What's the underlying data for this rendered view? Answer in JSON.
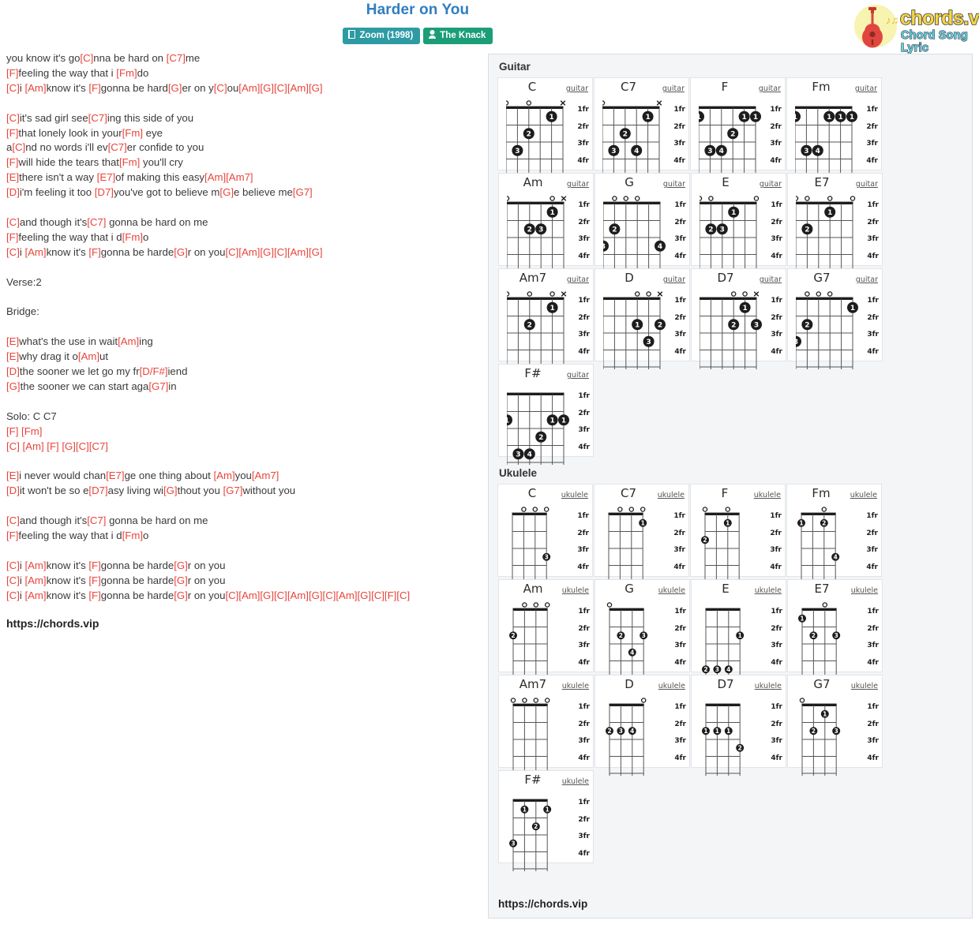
{
  "header": {
    "title": "Harder on You",
    "album_badge": "Zoom (1998)",
    "artist_badge": "The Knack",
    "album_icon": "book-icon",
    "artist_icon": "user-icon"
  },
  "logo": {
    "brand": "chords.vip",
    "tagline": "Chord Song Lyric",
    "icon": "guitar-icon",
    "note_icon": "music-note-icon",
    "disc_color": "#f7f3b0",
    "brand_color": "#f5d547",
    "tagline_color": "#63d2e8",
    "guitar_color": "#e0453f"
  },
  "colors": {
    "title": "#2f7ec0",
    "chord": "#e8453c",
    "album_badge": "#2e9ba4",
    "artist_badge": "#1b9e78",
    "panel_bg": "#f3f5f7"
  },
  "lyrics": {
    "footer_link": "https://chords.vip",
    "lines": [
      [
        {
          "t": "you know it's go"
        },
        {
          "c": "[C]"
        },
        {
          "t": "nna be hard on "
        },
        {
          "c": "[C7]"
        },
        {
          "t": "me"
        }
      ],
      [
        {
          "c": "[F]"
        },
        {
          "t": "feeling the way that i "
        },
        {
          "c": "[Fm]"
        },
        {
          "t": "do"
        }
      ],
      [
        {
          "c": "[C]"
        },
        {
          "t": "i "
        },
        {
          "c": "[Am]"
        },
        {
          "t": "know it's "
        },
        {
          "c": "[F]"
        },
        {
          "t": "gonna be hard"
        },
        {
          "c": "[G]"
        },
        {
          "t": "er on y"
        },
        {
          "c": "[C]"
        },
        {
          "t": "ou"
        },
        {
          "c": "[Am][G][C][Am][G]"
        }
      ],
      [],
      [
        {
          "c": "[C]"
        },
        {
          "t": "it's sad girl see"
        },
        {
          "c": "[C7]"
        },
        {
          "t": "ing this side of you"
        }
      ],
      [
        {
          "c": "[F]"
        },
        {
          "t": "that lonely look in your"
        },
        {
          "c": "[Fm]"
        },
        {
          "t": " eye"
        }
      ],
      [
        {
          "t": "a"
        },
        {
          "c": "[C]"
        },
        {
          "t": "nd no words i'll ev"
        },
        {
          "c": "[C7]"
        },
        {
          "t": "er confide to you"
        }
      ],
      [
        {
          "c": "[F]"
        },
        {
          "t": "will hide the tears that"
        },
        {
          "c": "[Fm]"
        },
        {
          "t": " you'll cry"
        }
      ],
      [
        {
          "c": "[E]"
        },
        {
          "t": "there isn't a way "
        },
        {
          "c": "[E7]"
        },
        {
          "t": "of making this easy"
        },
        {
          "c": "[Am][Am7]"
        }
      ],
      [
        {
          "c": "[D]"
        },
        {
          "t": "i'm feeling it too "
        },
        {
          "c": "[D7]"
        },
        {
          "t": "you've got to believe m"
        },
        {
          "c": "[G]"
        },
        {
          "t": "e believe me"
        },
        {
          "c": "[G7]"
        }
      ],
      [],
      [
        {
          "c": "[C]"
        },
        {
          "t": "and though it's"
        },
        {
          "c": "[C7]"
        },
        {
          "t": " gonna be hard on me"
        }
      ],
      [
        {
          "c": "[F]"
        },
        {
          "t": "feeling the way that i d"
        },
        {
          "c": "[Fm]"
        },
        {
          "t": "o"
        }
      ],
      [
        {
          "c": "[C]"
        },
        {
          "t": "i "
        },
        {
          "c": "[Am]"
        },
        {
          "t": "know it's "
        },
        {
          "c": "[F]"
        },
        {
          "t": "gonna be harde"
        },
        {
          "c": "[G]"
        },
        {
          "t": "r on you"
        },
        {
          "c": "[C][Am][G][C][Am][G]"
        }
      ],
      [],
      [
        {
          "t": "Verse:2"
        }
      ],
      [],
      [
        {
          "t": "Bridge:"
        }
      ],
      [],
      [
        {
          "c": "[E]"
        },
        {
          "t": "what's the use in wait"
        },
        {
          "c": "[Am]"
        },
        {
          "t": "ing"
        }
      ],
      [
        {
          "c": "[E]"
        },
        {
          "t": "why drag it o"
        },
        {
          "c": "[Am]"
        },
        {
          "t": "ut"
        }
      ],
      [
        {
          "c": "[D]"
        },
        {
          "t": "the sooner we let go my fr"
        },
        {
          "c": "[D/F#]"
        },
        {
          "t": "iend"
        }
      ],
      [
        {
          "c": "[G]"
        },
        {
          "t": "the sooner we can start aga"
        },
        {
          "c": "[G7]"
        },
        {
          "t": "in"
        }
      ],
      [],
      [
        {
          "t": "Solo: C C7"
        }
      ],
      [
        {
          "c": "[F] [Fm]"
        }
      ],
      [
        {
          "c": "[C] [Am] [F] [G][C][C7]"
        }
      ],
      [],
      [
        {
          "c": "[E]"
        },
        {
          "t": "i never would chan"
        },
        {
          "c": "[E7]"
        },
        {
          "t": "ge one thing about "
        },
        {
          "c": "[Am]"
        },
        {
          "t": "you"
        },
        {
          "c": "[Am7]"
        }
      ],
      [
        {
          "c": "[D]"
        },
        {
          "t": "it won't be so e"
        },
        {
          "c": "[D7]"
        },
        {
          "t": "asy living wi"
        },
        {
          "c": "[G]"
        },
        {
          "t": "thout you "
        },
        {
          "c": "[G7]"
        },
        {
          "t": "without you"
        }
      ],
      [],
      [
        {
          "c": "[C]"
        },
        {
          "t": "and though it's"
        },
        {
          "c": "[C7]"
        },
        {
          "t": " gonna be hard on me"
        }
      ],
      [
        {
          "c": "[F]"
        },
        {
          "t": "feeling the way that i d"
        },
        {
          "c": "[Fm]"
        },
        {
          "t": "o"
        }
      ],
      [],
      [
        {
          "c": "[C]"
        },
        {
          "t": "i "
        },
        {
          "c": "[Am]"
        },
        {
          "t": "know it's "
        },
        {
          "c": "[F]"
        },
        {
          "t": "gonna be harde"
        },
        {
          "c": "[G]"
        },
        {
          "t": "r on you"
        }
      ],
      [
        {
          "c": "[C]"
        },
        {
          "t": "i "
        },
        {
          "c": "[Am]"
        },
        {
          "t": "know it's "
        },
        {
          "c": "[F]"
        },
        {
          "t": "gonna be harde"
        },
        {
          "c": "[G]"
        },
        {
          "t": "r on you"
        }
      ],
      [
        {
          "c": "[C]"
        },
        {
          "t": "i "
        },
        {
          "c": "[Am]"
        },
        {
          "t": "know it's "
        },
        {
          "c": "[F]"
        },
        {
          "t": "gonna be harde"
        },
        {
          "c": "[G]"
        },
        {
          "t": "r on you"
        },
        {
          "c": "[C][Am][G][C][Am][G][C][Am][G][C][F][C]"
        }
      ]
    ]
  },
  "panel": {
    "guitar_section": "Guitar",
    "ukulele_section": "Ukulele",
    "footer_link": "https://chords.vip",
    "fret_labels": [
      "1fr",
      "2fr",
      "3fr",
      "4fr"
    ],
    "guitar_instrument_label": "guitar",
    "ukulele_instrument_label": "ukulele"
  },
  "guitar_chords": [
    {
      "name": "C",
      "open": [
        "x",
        "",
        "",
        "o",
        "",
        "o"
      ],
      "dots": [
        {
          "s": 2,
          "f": 1,
          "n": 1
        },
        {
          "s": 4,
          "f": 2,
          "n": 2
        },
        {
          "s": 5,
          "f": 3,
          "n": 3
        }
      ]
    },
    {
      "name": "C7",
      "open": [
        "x",
        "",
        "",
        "",
        "",
        "o"
      ],
      "dots": [
        {
          "s": 2,
          "f": 1,
          "n": 1
        },
        {
          "s": 4,
          "f": 2,
          "n": 2
        },
        {
          "s": 5,
          "f": 3,
          "n": 3
        },
        {
          "s": 3,
          "f": 3,
          "n": 4
        }
      ]
    },
    {
      "name": "F",
      "open": [
        "",
        "",
        "",
        "",
        "",
        ""
      ],
      "dots": [
        {
          "s": 6,
          "f": 1,
          "n": 1
        },
        {
          "s": 2,
          "f": 1,
          "n": 1
        },
        {
          "s": 1,
          "f": 1,
          "n": 1
        },
        {
          "s": 3,
          "f": 2,
          "n": 2
        },
        {
          "s": 5,
          "f": 3,
          "n": 3
        },
        {
          "s": 4,
          "f": 3,
          "n": 4
        }
      ]
    },
    {
      "name": "Fm",
      "open": [
        "",
        "",
        "",
        "",
        "",
        ""
      ],
      "dots": [
        {
          "s": 6,
          "f": 1,
          "n": 1
        },
        {
          "s": 3,
          "f": 1,
          "n": 1
        },
        {
          "s": 2,
          "f": 1,
          "n": 1
        },
        {
          "s": 1,
          "f": 1,
          "n": 1
        },
        {
          "s": 5,
          "f": 3,
          "n": 3
        },
        {
          "s": 4,
          "f": 3,
          "n": 4
        }
      ]
    },
    {
      "name": "Am",
      "open": [
        "x",
        "o",
        "",
        "",
        "",
        "o"
      ],
      "dots": [
        {
          "s": 2,
          "f": 1,
          "n": 1
        },
        {
          "s": 4,
          "f": 2,
          "n": 2
        },
        {
          "s": 3,
          "f": 2,
          "n": 3
        }
      ]
    },
    {
      "name": "G",
      "open": [
        "",
        "",
        "o",
        "o",
        "o",
        ""
      ],
      "dots": [
        {
          "s": 6,
          "f": 3,
          "n": 3
        },
        {
          "s": 5,
          "f": 2,
          "n": 2
        },
        {
          "s": 1,
          "f": 3,
          "n": 4
        }
      ]
    },
    {
      "name": "E",
      "open": [
        "o",
        "",
        "",
        "",
        "o",
        "o"
      ],
      "dots": [
        {
          "s": 3,
          "f": 1,
          "n": 1
        },
        {
          "s": 5,
          "f": 2,
          "n": 2
        },
        {
          "s": 4,
          "f": 2,
          "n": 3
        }
      ]
    },
    {
      "name": "E7",
      "open": [
        "o",
        "",
        "o",
        "",
        "o",
        "o"
      ],
      "dots": [
        {
          "s": 3,
          "f": 1,
          "n": 1
        },
        {
          "s": 5,
          "f": 2,
          "n": 2
        }
      ]
    },
    {
      "name": "Am7",
      "open": [
        "x",
        "o",
        "",
        "o",
        "",
        "o"
      ],
      "dots": [
        {
          "s": 2,
          "f": 1,
          "n": 1
        },
        {
          "s": 4,
          "f": 2,
          "n": 2
        }
      ]
    },
    {
      "name": "D",
      "open": [
        "x",
        "o",
        "o",
        "",
        "",
        ""
      ],
      "dots": [
        {
          "s": 3,
          "f": 2,
          "n": 1
        },
        {
          "s": 1,
          "f": 2,
          "n": 2
        },
        {
          "s": 2,
          "f": 3,
          "n": 3
        }
      ]
    },
    {
      "name": "D7",
      "open": [
        "x",
        "o",
        "o",
        "",
        "",
        ""
      ],
      "dots": [
        {
          "s": 2,
          "f": 1,
          "n": 1
        },
        {
          "s": 3,
          "f": 2,
          "n": 2
        },
        {
          "s": 1,
          "f": 2,
          "n": 3
        }
      ]
    },
    {
      "name": "G7",
      "open": [
        "",
        "",
        "o",
        "o",
        "o",
        ""
      ],
      "dots": [
        {
          "s": 1,
          "f": 1,
          "n": 1
        },
        {
          "s": 5,
          "f": 2,
          "n": 2
        },
        {
          "s": 6,
          "f": 3,
          "n": 3
        }
      ]
    },
    {
      "name": "F#",
      "open": [
        "",
        "",
        "",
        "",
        "",
        ""
      ],
      "dots": [
        {
          "s": 6,
          "f": 2,
          "n": 1
        },
        {
          "s": 2,
          "f": 2,
          "n": 1
        },
        {
          "s": 1,
          "f": 2,
          "n": 1
        },
        {
          "s": 3,
          "f": 3,
          "n": 2
        },
        {
          "s": 5,
          "f": 4,
          "n": 3
        },
        {
          "s": 4,
          "f": 4,
          "n": 4
        }
      ]
    }
  ],
  "ukulele_chords": [
    {
      "name": "C",
      "open": [
        "o",
        "o",
        "o",
        ""
      ],
      "dots": [
        {
          "s": 1,
          "f": 3,
          "n": 3
        }
      ]
    },
    {
      "name": "C7",
      "open": [
        "o",
        "o",
        "o",
        ""
      ],
      "dots": [
        {
          "s": 1,
          "f": 1,
          "n": 1
        }
      ]
    },
    {
      "name": "F",
      "open": [
        "",
        "o",
        "",
        "o"
      ],
      "dots": [
        {
          "s": 2,
          "f": 1,
          "n": 1
        },
        {
          "s": 4,
          "f": 2,
          "n": 2
        }
      ]
    },
    {
      "name": "Fm",
      "open": [
        "",
        "o",
        "",
        ""
      ],
      "dots": [
        {
          "s": 4,
          "f": 1,
          "n": 1
        },
        {
          "s": 2,
          "f": 1,
          "n": 2
        },
        {
          "s": 1,
          "f": 3,
          "n": 4
        }
      ]
    },
    {
      "name": "Am",
      "open": [
        "o",
        "o",
        "o",
        ""
      ],
      "dots": [
        {
          "s": 4,
          "f": 2,
          "n": 2
        }
      ]
    },
    {
      "name": "G",
      "open": [
        "",
        "",
        "",
        "o"
      ],
      "dots": [
        {
          "s": 3,
          "f": 2,
          "n": 2
        },
        {
          "s": 1,
          "f": 2,
          "n": 3
        },
        {
          "s": 2,
          "f": 3,
          "n": 4
        }
      ]
    },
    {
      "name": "E",
      "open": [
        "",
        "",
        "",
        ""
      ],
      "dots": [
        {
          "s": 1,
          "f": 2,
          "n": 1
        },
        {
          "s": 4,
          "f": 4,
          "n": 2
        },
        {
          "s": 3,
          "f": 4,
          "n": 3
        },
        {
          "s": 2,
          "f": 4,
          "n": 4
        }
      ]
    },
    {
      "name": "E7",
      "open": [
        "",
        "o",
        "",
        ""
      ],
      "dots": [
        {
          "s": 4,
          "f": 1,
          "n": 1
        },
        {
          "s": 3,
          "f": 2,
          "n": 2
        },
        {
          "s": 1,
          "f": 2,
          "n": 3
        }
      ]
    },
    {
      "name": "Am7",
      "open": [
        "o",
        "o",
        "o",
        "o"
      ],
      "dots": []
    },
    {
      "name": "D",
      "open": [
        "o",
        "",
        "",
        ""
      ],
      "dots": [
        {
          "s": 4,
          "f": 2,
          "n": 2
        },
        {
          "s": 3,
          "f": 2,
          "n": 3
        },
        {
          "s": 2,
          "f": 2,
          "n": 4
        }
      ]
    },
    {
      "name": "D7",
      "open": [
        "",
        "",
        "",
        ""
      ],
      "dots": [
        {
          "s": 4,
          "f": 2,
          "n": 1
        },
        {
          "s": 3,
          "f": 2,
          "n": 1
        },
        {
          "s": 2,
          "f": 2,
          "n": 1
        },
        {
          "s": 1,
          "f": 3,
          "n": 2
        }
      ]
    },
    {
      "name": "G7",
      "open": [
        "",
        "",
        "",
        "o"
      ],
      "dots": [
        {
          "s": 2,
          "f": 1,
          "n": 1
        },
        {
          "s": 3,
          "f": 2,
          "n": 2
        },
        {
          "s": 1,
          "f": 2,
          "n": 3
        }
      ]
    },
    {
      "name": "F#",
      "open": [
        "",
        "",
        "",
        ""
      ],
      "dots": [
        {
          "s": 3,
          "f": 1,
          "n": 1
        },
        {
          "s": 1,
          "f": 1,
          "n": 1
        },
        {
          "s": 2,
          "f": 2,
          "n": 2
        },
        {
          "s": 4,
          "f": 3,
          "n": 3
        }
      ]
    }
  ]
}
